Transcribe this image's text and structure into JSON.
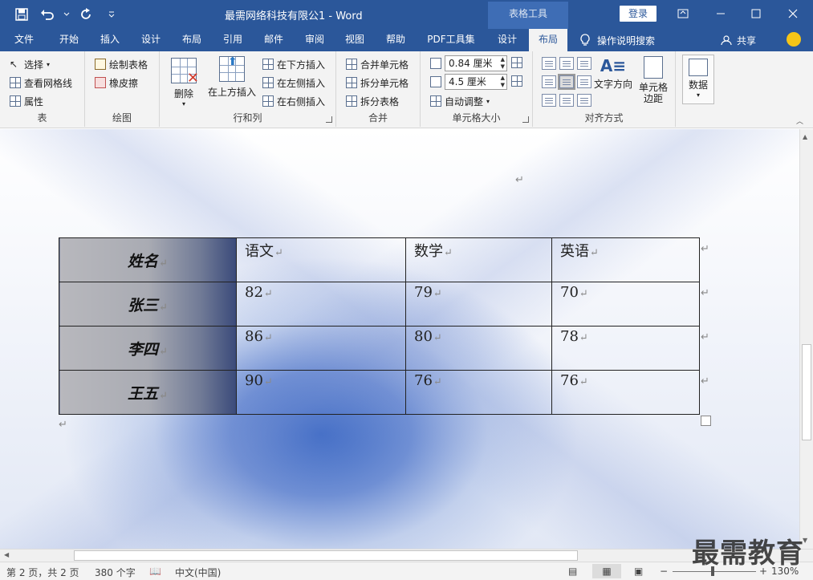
{
  "window": {
    "doc_title": "最需网络科技有限公1  -  Word",
    "context_tools": "表格工具",
    "login_label": "登录"
  },
  "tabs": [
    {
      "label": "文件"
    },
    {
      "label": "开始"
    },
    {
      "label": "插入"
    },
    {
      "label": "设计"
    },
    {
      "label": "布局"
    },
    {
      "label": "引用"
    },
    {
      "label": "邮件"
    },
    {
      "label": "审阅"
    },
    {
      "label": "视图"
    },
    {
      "label": "帮助"
    },
    {
      "label": "PDF工具集"
    },
    {
      "label": "设计"
    },
    {
      "label": "布局"
    }
  ],
  "tell_me": "操作说明搜索",
  "share": "共享",
  "ribbon": {
    "table_group": {
      "label": "表",
      "select": "选择",
      "gridlines": "查看网格线",
      "properties": "属性"
    },
    "draw_group": {
      "label": "绘图",
      "draw_table": "绘制表格",
      "eraser": "橡皮擦"
    },
    "rows_cols_group": {
      "label": "行和列",
      "delete": "删除",
      "insert_above": "在上方插入",
      "insert_below": "在下方插入",
      "insert_left": "在左侧插入",
      "insert_right": "在右侧插入"
    },
    "merge_group": {
      "label": "合并",
      "merge_cells": "合并单元格",
      "split_cells": "拆分单元格",
      "split_table": "拆分表格"
    },
    "cell_size_group": {
      "label": "单元格大小",
      "height_value": "0.84 厘米",
      "width_value": "4.5 厘米",
      "autofit": "自动调整"
    },
    "alignment_group": {
      "label": "对齐方式",
      "text_direction": "文字方向",
      "cell_margins_line1": "单元格",
      "cell_margins_line2": "边距"
    },
    "data_group": {
      "label": "数据"
    }
  },
  "table": {
    "header": [
      "姓名",
      "语文",
      "数学",
      "英语"
    ],
    "rows": [
      [
        "张三",
        "82",
        "79",
        "70"
      ],
      [
        "李四",
        "86",
        "80",
        "78"
      ],
      [
        "王五",
        "90",
        "76",
        "76"
      ]
    ]
  },
  "paragraph_mark": "↵",
  "status": {
    "page": "第 2 页，共 2 页",
    "words": "380 个字",
    "language": "中文(中国)",
    "zoom": "130%"
  },
  "watermark": "最需教育"
}
